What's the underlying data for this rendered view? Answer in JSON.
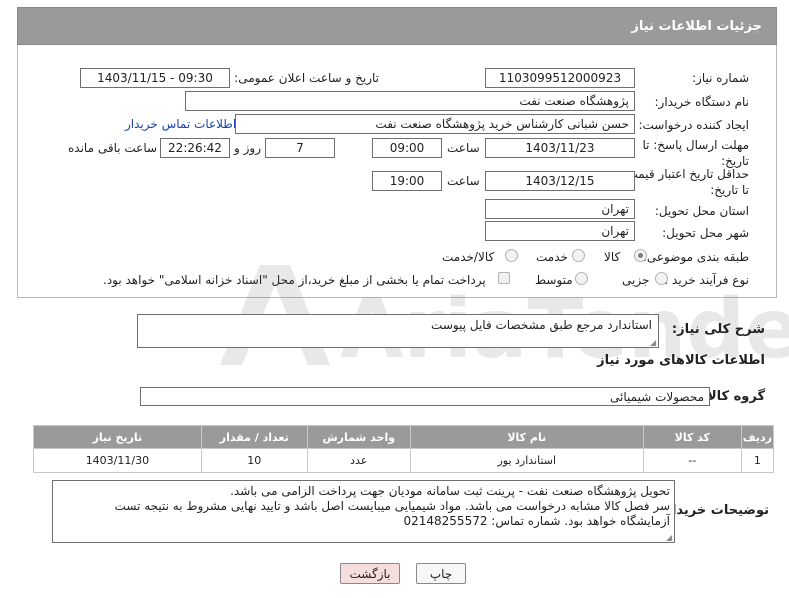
{
  "panel_title": "جزئیات اطلاعات نیاز",
  "need_number": {
    "label": "شماره نیاز:",
    "value": "1103099512000923"
  },
  "announce": {
    "label": "تاریخ و ساعت اعلان عمومی:",
    "value": "1403/11/15 - 09:30"
  },
  "buyer_org": {
    "label": "نام دستگاه خریدار:",
    "value": "پژوهشگاه صنعت نفت"
  },
  "creator": {
    "label": "ایجاد کننده درخواست:",
    "value": "حسن شبانی کارشناس خرید پژوهشگاه صنعت نفت",
    "contact_link": "اطلاعات تماس خریدار"
  },
  "reply_deadline": {
    "label": "مهلت ارسال پاسخ: تا تاریخ:",
    "date": "1403/11/23",
    "time_label": "ساعت",
    "time": "09:00",
    "days": "7",
    "days_label": "روز و",
    "remaining": "22:26:42",
    "remaining_label": "ساعت باقی مانده"
  },
  "price_validity": {
    "label": "حداقل تاریخ اعتبار قیمت: تا تاریخ:",
    "date": "1403/12/15",
    "time_label": "ساعت",
    "time": "19:00"
  },
  "province": {
    "label": "استان محل تحویل:",
    "value": "تهران"
  },
  "city": {
    "label": "شهر محل تحویل:",
    "value": "تهران"
  },
  "category": {
    "label": "طبقه بندی موضوعی:",
    "options": [
      "کالا",
      "خدمت",
      "کالا/خدمت"
    ],
    "selected": "کالا"
  },
  "purchase_type": {
    "label": "نوع فرآیند خرید :",
    "options": [
      "جزیی",
      "متوسط"
    ],
    "payment_note": "پرداخت تمام یا بخشی از مبلغ خرید،از محل \"اسناد خزانه اسلامی\" خواهد بود."
  },
  "description": {
    "label": "شرح کلی نیاز:",
    "value": "استاندارد مرجع طبق مشخصات فایل پیوست"
  },
  "goods_section_title": "اطلاعات کالاهای مورد نیاز",
  "goods_group": {
    "label": "گروه کالا:",
    "value": "محصولات شیمیائی"
  },
  "table": {
    "headers": [
      "ردیف",
      "کد کالا",
      "نام کالا",
      "واحد شمارش",
      "تعداد / مقدار",
      "تاریخ نیاز"
    ],
    "rows": [
      [
        "1",
        "--",
        "استاندارد یور",
        "عدد",
        "10",
        "1403/11/30"
      ]
    ]
  },
  "buyer_notes": {
    "label": "توضیحات خریدار:",
    "lines": [
      "تحویل پژوهشگاه صنعت نفت - پرینت ثبت سامانه مودیان جهت پرداخت الزامی می باشد.",
      "سر فصل کالا مشابه درخواست می باشد. مواد شیمیایی میبایست اصل باشد و تایید نهایی مشروط به نتیجه تست",
      "آزمایشگاه خواهد بود. شماره تماس: 02148255572"
    ]
  },
  "buttons": {
    "print": "چاپ",
    "back": "بازگشت"
  },
  "watermark_text": "AriaTender.neT",
  "colors": {
    "header_gray": "#9a9a9a",
    "link_blue": "#1a44b0",
    "back_button": "#f6dede"
  }
}
